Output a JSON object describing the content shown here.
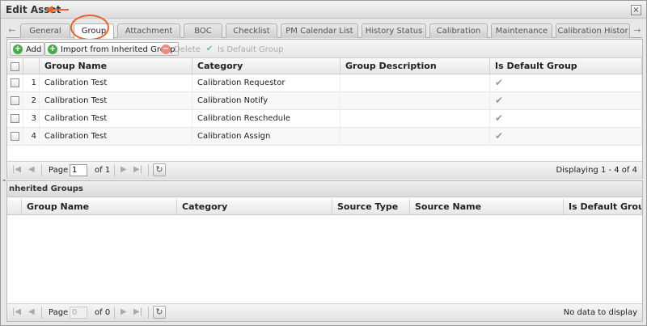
{
  "window": {
    "title": "Edit Asset",
    "close_symbol": "×"
  },
  "tabs": [
    {
      "label": "General"
    },
    {
      "label": "Group"
    },
    {
      "label": "Attachment"
    },
    {
      "label": "BOC"
    },
    {
      "label": "Checklist"
    },
    {
      "label": "PM Calendar List"
    },
    {
      "label": "History Status"
    },
    {
      "label": "Calibration"
    },
    {
      "label": "Maintenance"
    },
    {
      "label": "Calibration Histor"
    }
  ],
  "active_tab": "Group",
  "toolbar": {
    "add_label": "Add",
    "import_label": "Import from Inherited Group",
    "delete_label": "Delete",
    "default_label": "Is Default Group"
  },
  "group_grid": {
    "columns": [
      "Group Name",
      "Category",
      "Group Description",
      "Is Default Group"
    ],
    "rows": [
      {
        "num": "1",
        "group_name": "Calibration Test",
        "category": "Calibration Requestor",
        "description": "",
        "is_default": true
      },
      {
        "num": "2",
        "group_name": "Calibration Test",
        "category": "Calibration Notify",
        "description": "",
        "is_default": true
      },
      {
        "num": "3",
        "group_name": "Calibration Test",
        "category": "Calibration Reschedule",
        "description": "",
        "is_default": true
      },
      {
        "num": "4",
        "group_name": "Calibration Test",
        "category": "Calibration Assign",
        "description": "",
        "is_default": true
      }
    ]
  },
  "pager1": {
    "page_label": "Page",
    "page_value": "1",
    "of_label": "of 1",
    "display": "Displaying 1 - 4 of 4"
  },
  "inherited": {
    "title": "nherited Groups",
    "columns": [
      "Group Name",
      "Category",
      "Source Type",
      "Source Name",
      "Is Default Group"
    ]
  },
  "pager2": {
    "page_label": "Page",
    "page_value": "0",
    "of_label": "of 0",
    "display": "No data to display"
  },
  "colors": {
    "annotation": "#e8642a"
  }
}
